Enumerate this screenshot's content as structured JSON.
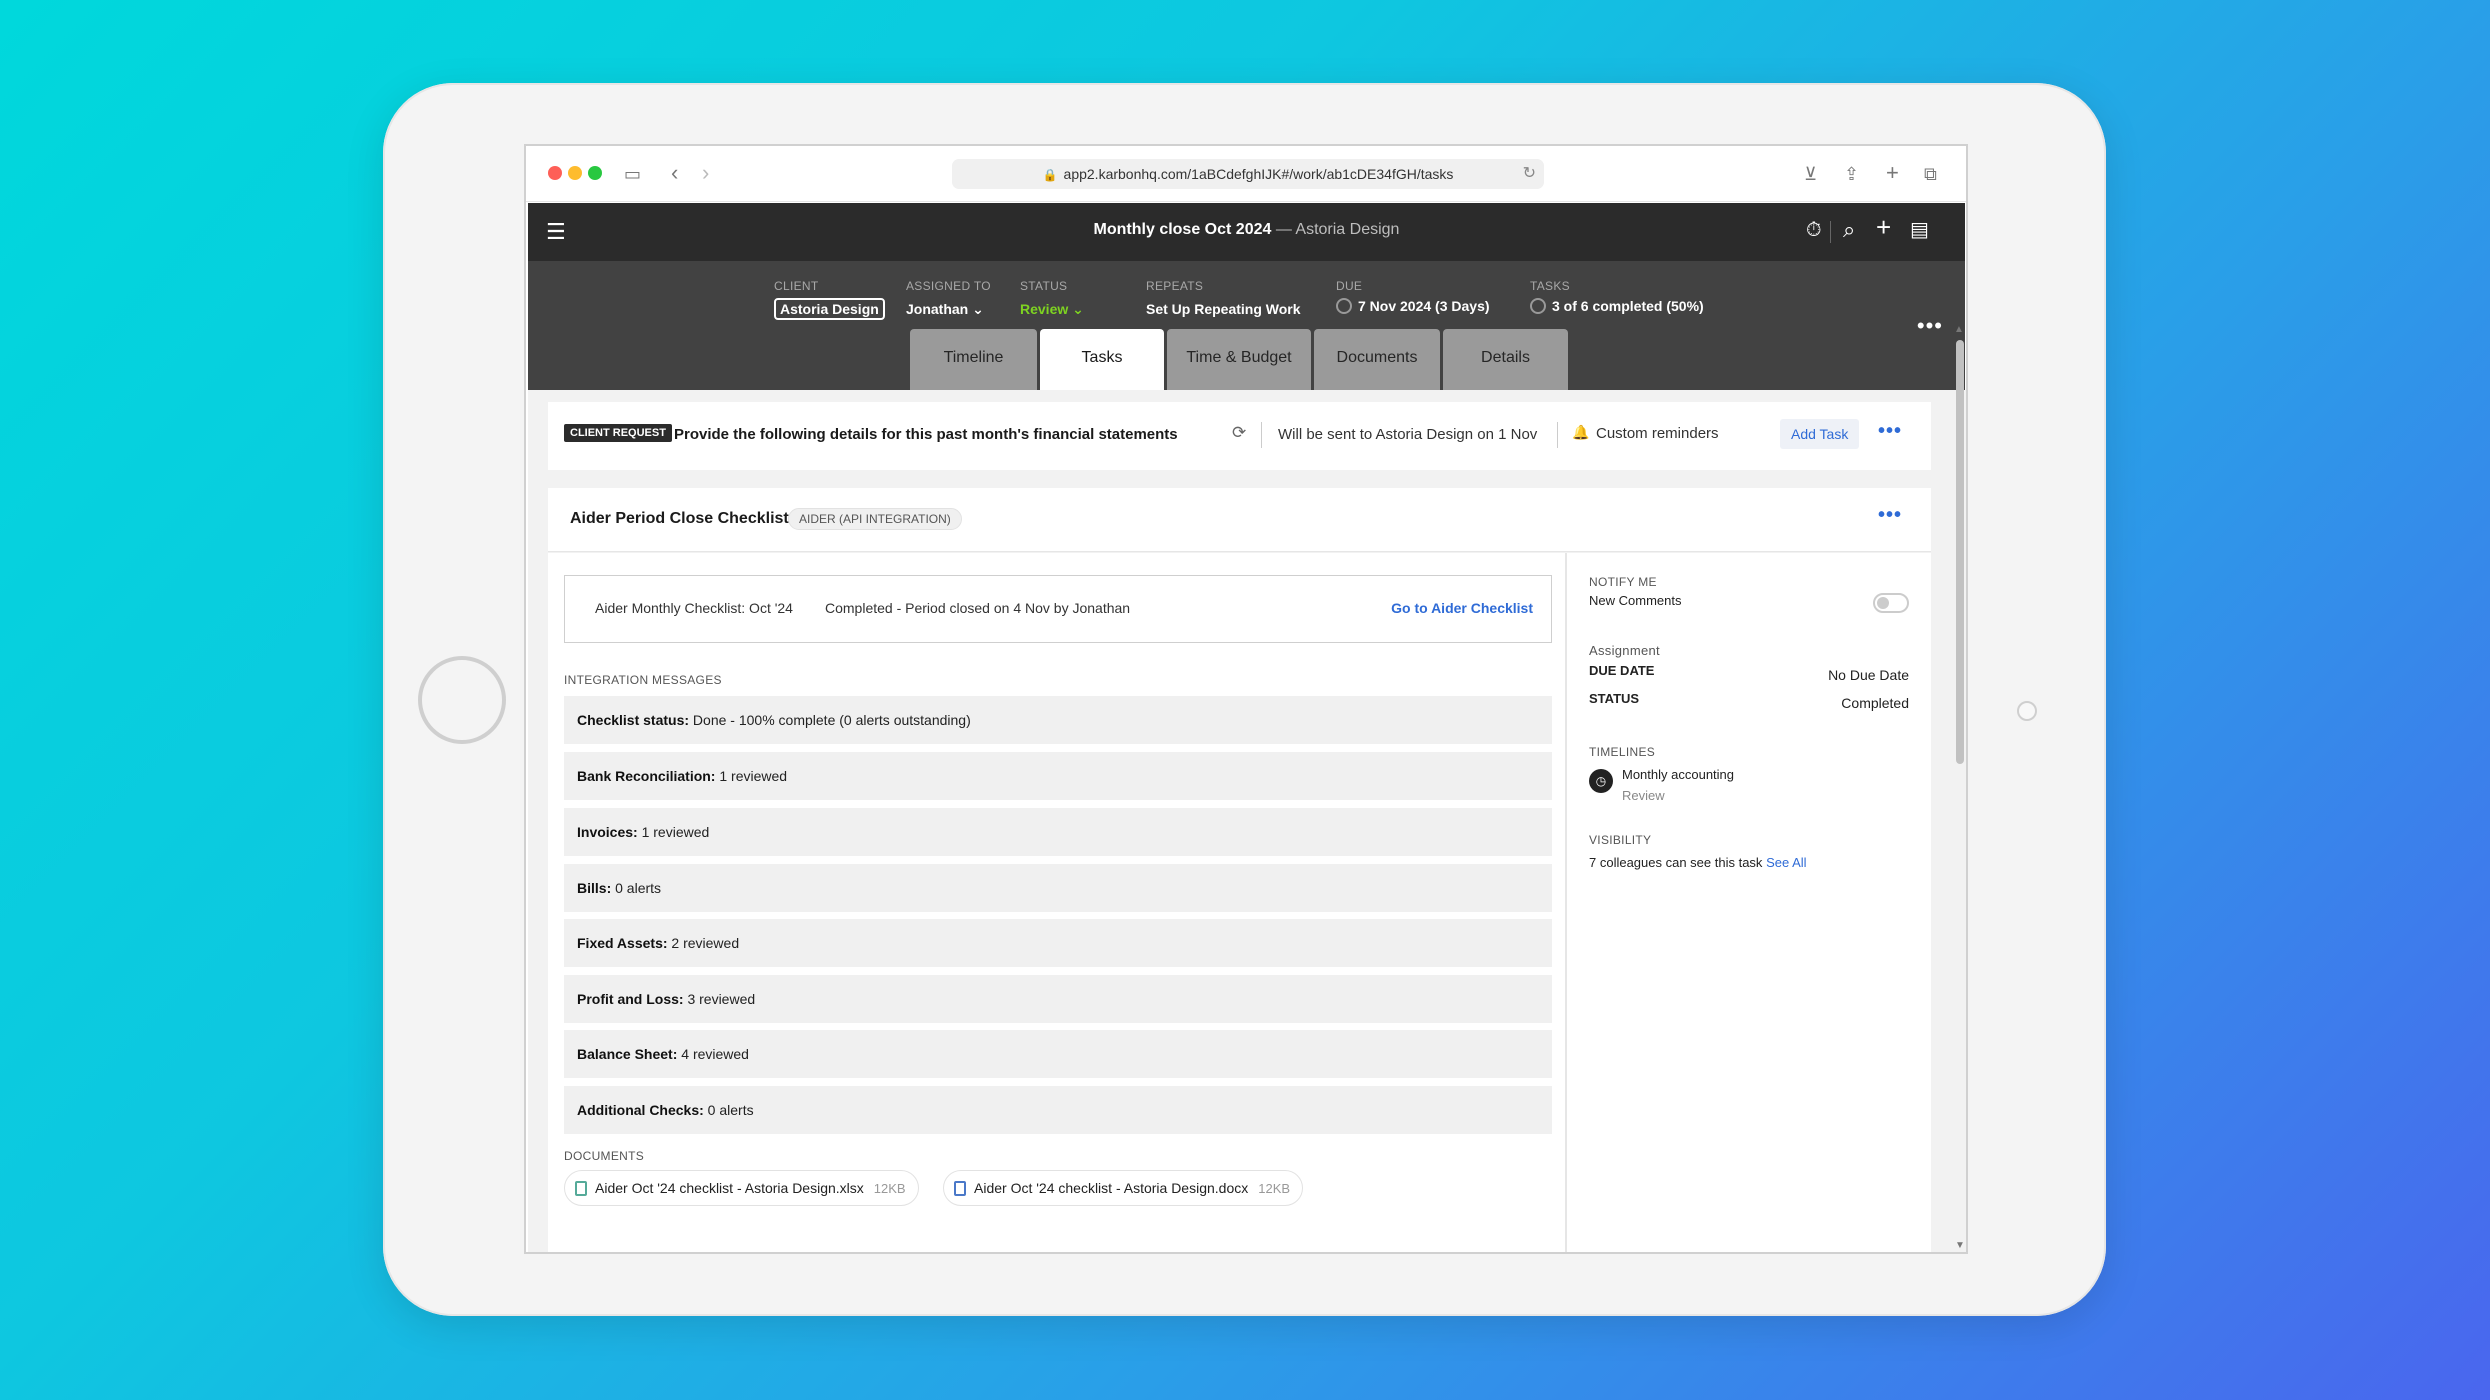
{
  "browser": {
    "url": "app2.karbonhq.com/1aBCdefghIJK#/work/ab1cDE34fGH/tasks"
  },
  "header": {
    "title": "Monthly close Oct 2024",
    "separator": " — ",
    "client": "Astoria Design"
  },
  "meta": {
    "client_label": "CLIENT",
    "client_value": "Astoria Design",
    "assigned_label": "ASSIGNED TO",
    "assigned_value": "Jonathan",
    "status_label": "STATUS",
    "status_value": "Review",
    "repeats_label": "REPEATS",
    "repeats_value": "Set Up Repeating Work",
    "due_label": "DUE",
    "due_value": "7 Nov 2024 (3 Days)",
    "tasks_label": "TASKS",
    "tasks_value": "3 of 6 completed (50%)",
    "status_color": "#7ed321"
  },
  "tabs": [
    {
      "label": "Timeline"
    },
    {
      "label": "Tasks",
      "active": true
    },
    {
      "label": "Time & Budget"
    },
    {
      "label": "Documents"
    },
    {
      "label": "Details"
    }
  ],
  "client_request": {
    "badge": "CLIENT REQUEST",
    "text": "Provide the following details for this past month's financial statements",
    "sent_text": "Will be sent to Astoria Design on 1 Nov",
    "reminders": "Custom reminders",
    "add_task": "Add Task"
  },
  "checklist": {
    "title": "Aider Period Close Checklist",
    "tag": "AIDER (API INTEGRATION)",
    "summary_name": "Aider Monthly Checklist: Oct '24",
    "summary_status": "Completed - Period closed on 4 Nov by Jonathan",
    "go_link": "Go to Aider Checklist",
    "messages_label": "INTEGRATION MESSAGES",
    "messages": [
      {
        "key": "Checklist status:",
        "value": " Done - 100% complete (0 alerts outstanding)"
      },
      {
        "key": "Bank Reconciliation:",
        "value": " 1 reviewed"
      },
      {
        "key": "Invoices:",
        "value": " 1 reviewed"
      },
      {
        "key": "Bills:",
        "value": " 0 alerts"
      },
      {
        "key": "Fixed Assets:",
        "value": " 2 reviewed"
      },
      {
        "key": "Profit and Loss:",
        "value": " 3 reviewed"
      },
      {
        "key": "Balance Sheet:",
        "value": " 4 reviewed"
      },
      {
        "key": "Additional Checks:",
        "value": " 0 alerts"
      }
    ],
    "documents_label": "DOCUMENTS",
    "documents": [
      {
        "name": "Aider Oct '24 checklist - Astoria Design.xlsx",
        "size": "12KB"
      },
      {
        "name": "Aider Oct '24 checklist - Astoria Design.docx",
        "size": "12KB"
      }
    ]
  },
  "sidebar": {
    "notify_label": "NOTIFY ME",
    "new_comments": "New Comments",
    "assignment_label": "Assignment",
    "due_date_label": "DUE DATE",
    "due_date_value": "No Due Date",
    "status_label": "STATUS",
    "status_value": "Completed",
    "timelines_label": "TIMELINES",
    "timeline_name": "Monthly accounting",
    "timeline_status": "Review",
    "visibility_label": "VISIBILITY",
    "visibility_text": "7 colleagues can see this task",
    "see_all": "See All"
  },
  "icons": {
    "menu": "hamburger-icon",
    "timer": "timer-icon",
    "search": "search-icon",
    "add": "plus-icon",
    "notes": "notes-icon"
  }
}
